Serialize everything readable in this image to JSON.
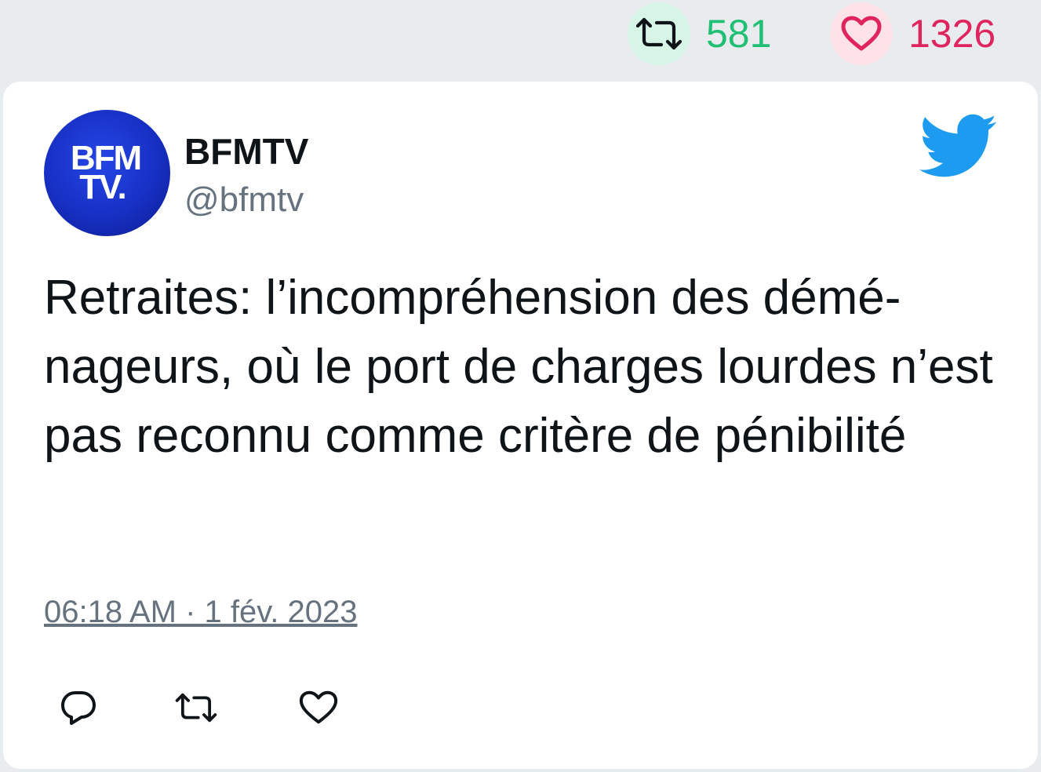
{
  "stats": {
    "retweets": "581",
    "likes": "1326",
    "retweet_color": "#1fbf74",
    "like_color": "#e0245e"
  },
  "author": {
    "name": "BFMTV",
    "handle": "@bfmtv",
    "avatar_text_line1": "BFM",
    "avatar_text_line2": "TV."
  },
  "tweet": {
    "text": "Retraites: l’incompréhension des démé-nageurs, où le port de charges lourdes n’est pas reconnu comme critère de pénibilité",
    "timestamp": "06:18 AM · 1 fév. 2023"
  },
  "icons": {
    "brand": "twitter-bird-icon",
    "actions": [
      "reply-icon",
      "retweet-icon",
      "like-icon"
    ]
  }
}
